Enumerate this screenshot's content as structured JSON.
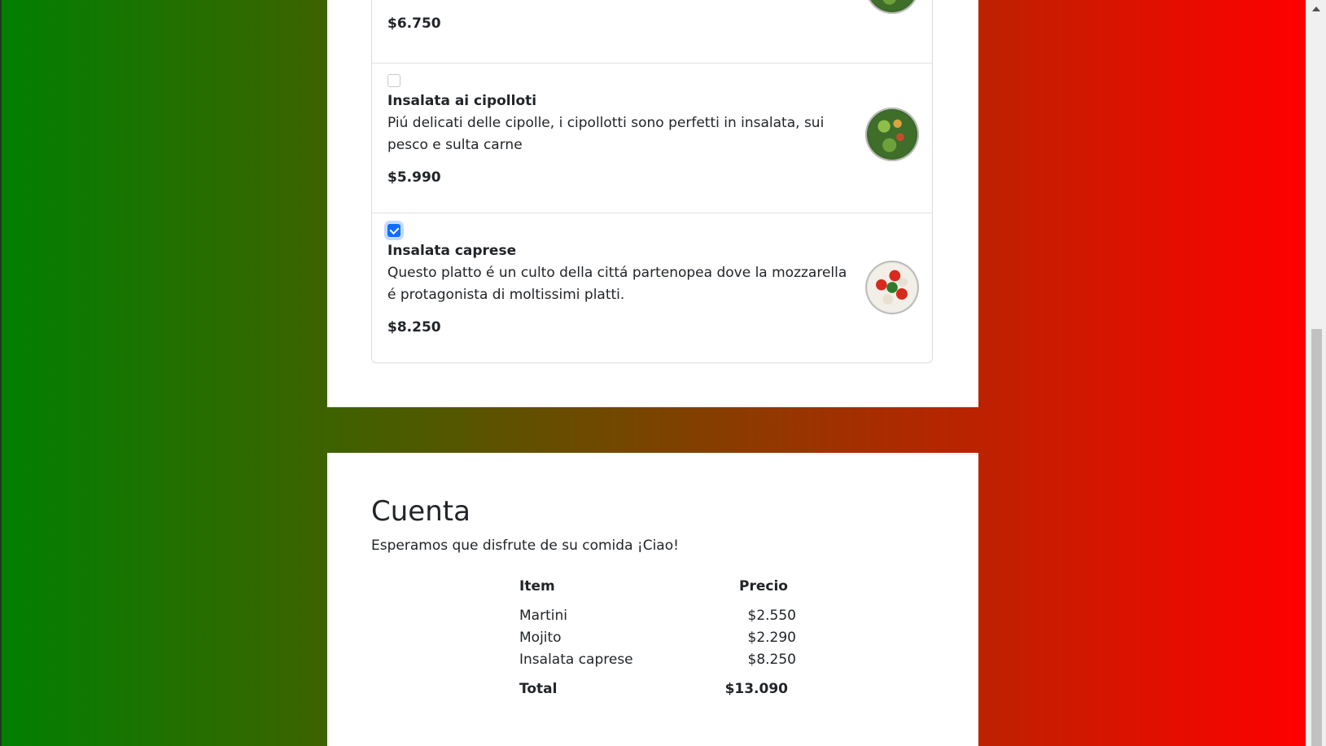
{
  "menu_items": [
    {
      "title": "",
      "description": "",
      "price": "$6.750",
      "checked": false
    },
    {
      "title": "Insalata ai cipolloti",
      "description": "Piú delicati delle cipolle, i cipollotti sono perfetti in insalata, sui pesco e sulta carne",
      "price": "$5.990",
      "checked": false
    },
    {
      "title": "Insalata caprese",
      "description": "Questo platto é un culto della cittá partenopea dove la mozzarella é protagonista di moltissimi platti.",
      "price": "$8.250",
      "checked": true
    }
  ],
  "cuenta": {
    "title": "Cuenta",
    "subtitle": "Esperamos que disfrute de su comida ¡Ciao!",
    "headers": {
      "item": "Item",
      "price": "Precio"
    },
    "rows": [
      {
        "item": "Martini",
        "price": "$2.550"
      },
      {
        "item": "Mojito",
        "price": "$2.290"
      },
      {
        "item": "Insalata caprese",
        "price": "$8.250"
      }
    ],
    "total_label": "Total",
    "total_value": "$13.090"
  },
  "colors": {
    "accent": "#0d6efd",
    "bg_left": "#008000",
    "bg_right": "#ff0000"
  }
}
